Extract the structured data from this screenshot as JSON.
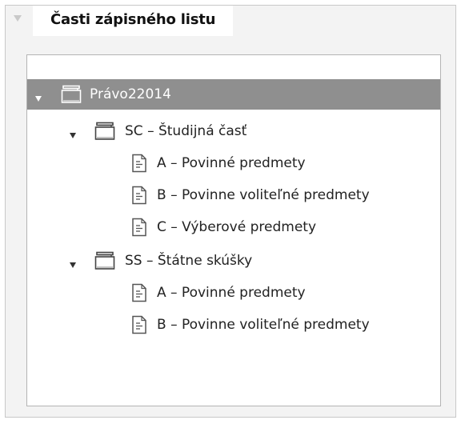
{
  "panel": {
    "title": "Časti zápisného listu"
  },
  "tree": {
    "root": {
      "label": "Právo22014",
      "icon": "folder-icon",
      "expanded": true,
      "selected": true
    },
    "groups": [
      {
        "label": "SC – Študijná časť",
        "icon": "folder-icon",
        "expanded": true,
        "items": [
          {
            "label": "A – Povinné predmety",
            "icon": "document-icon"
          },
          {
            "label": "B – Povinne voliteľné predmety",
            "icon": "document-icon"
          },
          {
            "label": "C – Výberové predmety",
            "icon": "document-icon"
          }
        ]
      },
      {
        "label": "SS – Štátne skúšky",
        "icon": "folder-icon",
        "expanded": true,
        "items": [
          {
            "label": "A – Povinné predmety",
            "icon": "document-icon"
          },
          {
            "label": "B – Povinne voliteľné predmety",
            "icon": "document-icon"
          }
        ]
      }
    ]
  },
  "colors": {
    "selected_row": "#8f8f8f",
    "panel_background": "#f3f3f3"
  }
}
